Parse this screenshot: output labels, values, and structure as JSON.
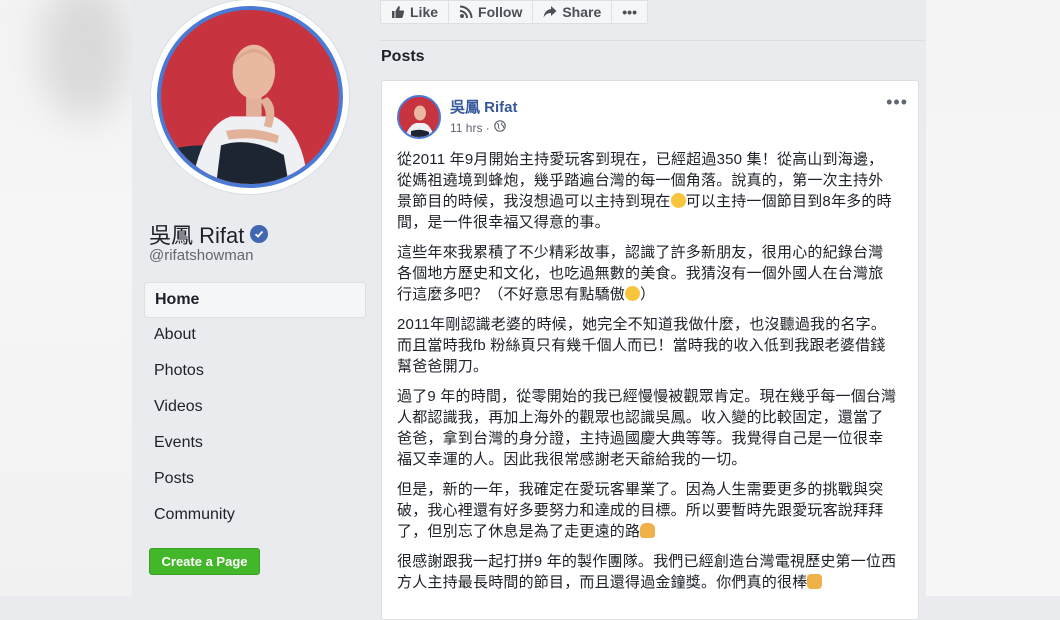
{
  "page": {
    "name": "吳鳳 Rifat",
    "handle": "@rifatshowman"
  },
  "nav": [
    {
      "label": "Home"
    },
    {
      "label": "About"
    },
    {
      "label": "Photos"
    },
    {
      "label": "Videos"
    },
    {
      "label": "Events"
    },
    {
      "label": "Posts"
    },
    {
      "label": "Community"
    }
  ],
  "create_page_label": "Create a Page",
  "actions": {
    "like": "Like",
    "follow": "Follow",
    "share": "Share",
    "more": "•••"
  },
  "posts_heading": "Posts",
  "post": {
    "author": "吳鳳 Rifat",
    "time": "11 hrs · ",
    "more": "•••",
    "paragraphs": [
      "從2011 年9月開始主持愛玩客到現在，已經超過350 集！從高山到海邊，從媽祖遶境到蜂炮，幾乎踏遍台灣的每一個角落。說真的，第一次主持外景節目的時候，我沒想過可以主持到現在",
      "可以主持一個節目到8年多的時間，是一件很幸福又得意的事。",
      "這些年來我累積了不少精彩故事，認識了許多新朋友，很用心的紀錄台灣各個地方歷史和文化，也吃過無數的美食。我猜沒有一個外國人在台灣旅行這麼多吧？（不好意思有點驕傲",
      "）",
      "2011年剛認識老婆的時候，她完全不知道我做什麼，也沒聽過我的名字。而且當時我fb 粉絲頁只有幾千個人而已！當時我的收入低到我跟老婆借錢幫爸爸開刀。",
      "過了9 年的時間，從零開始的我已經慢慢被觀眾肯定。現在幾乎每一個台灣人都認識我，再加上海外的觀眾也認識吳鳳。收入變的比較固定，還當了爸爸，拿到台灣的身分證，主持過國慶大典等等。我覺得自己是一位很幸福又幸運的人。因此我很常感謝老天爺給我的一切。",
      "但是，新的一年，我確定在愛玩客畢業了。因為人生需要更多的挑戰與突破，我心裡還有好多要努力和達成的目標。所以要暫時先跟愛玩客說拜拜了，但別忘了休息是為了走更遠的路",
      "很感謝跟我一起打拼9 年的製作團隊。我們已經創造台灣電視歷史第一位西方人主持最長時間的節目，而且還得過金鐘獎。你們真的很棒"
    ]
  },
  "colors": {
    "accent": "#4267b2",
    "link": "#365899",
    "green": "#42b72a",
    "ring": "#4b7ad5",
    "avatar_bg": "#c73440"
  }
}
